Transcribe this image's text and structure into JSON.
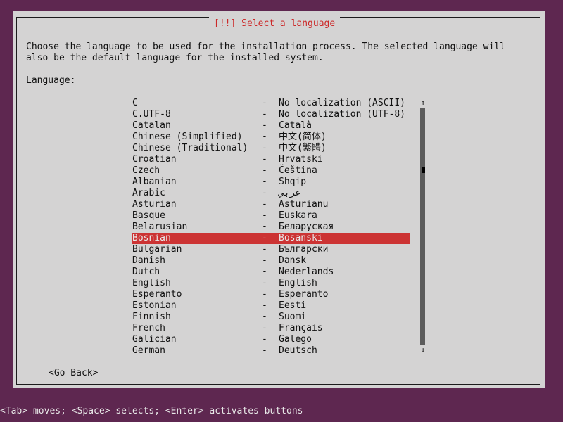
{
  "dialog": {
    "title": "[!!] Select a language",
    "description": "Choose the language to be used for the installation process. The selected language will also be the default language for the installed system.",
    "field_label": "Language:"
  },
  "languages": [
    {
      "en": "C",
      "dash": "-",
      "native": "No localization (ASCII)"
    },
    {
      "en": "C.UTF-8",
      "dash": "-",
      "native": "No localization (UTF-8)"
    },
    {
      "en": "Catalan",
      "dash": "-",
      "native": "Català"
    },
    {
      "en": "Chinese (Simplified)",
      "dash": "-",
      "native": "中文(简体)"
    },
    {
      "en": "Chinese (Traditional)",
      "dash": "-",
      "native": "中文(繁體)"
    },
    {
      "en": "Croatian",
      "dash": "-",
      "native": "Hrvatski"
    },
    {
      "en": "Czech",
      "dash": "-",
      "native": "Čeština"
    },
    {
      "en": "Albanian",
      "dash": "-",
      "native": "Shqip"
    },
    {
      "en": "Arabic",
      "dash": "-",
      "native": "عربي"
    },
    {
      "en": "Asturian",
      "dash": "-",
      "native": "Asturianu"
    },
    {
      "en": "Basque",
      "dash": "-",
      "native": "Euskara"
    },
    {
      "en": "Belarusian",
      "dash": "-",
      "native": "Беларуская"
    },
    {
      "en": "Bosnian",
      "dash": "-",
      "native": "Bosanski"
    },
    {
      "en": "Bulgarian",
      "dash": "-",
      "native": "Български"
    },
    {
      "en": "Danish",
      "dash": "-",
      "native": "Dansk"
    },
    {
      "en": "Dutch",
      "dash": "-",
      "native": "Nederlands"
    },
    {
      "en": "English",
      "dash": "-",
      "native": "English"
    },
    {
      "en": "Esperanto",
      "dash": "-",
      "native": "Esperanto"
    },
    {
      "en": "Estonian",
      "dash": "-",
      "native": "Eesti"
    },
    {
      "en": "Finnish",
      "dash": "-",
      "native": "Suomi"
    },
    {
      "en": "French",
      "dash": "-",
      "native": "Français"
    },
    {
      "en": "Galician",
      "dash": "-",
      "native": "Galego"
    },
    {
      "en": "German",
      "dash": "-",
      "native": "Deutsch"
    }
  ],
  "selected_language": "Bosnian",
  "scrollbar": {
    "up_glyph": "↑",
    "down_glyph": "↓"
  },
  "buttons": {
    "go_back": "<Go Back>"
  },
  "footer": {
    "help": "<Tab> moves; <Space> selects; <Enter> activates buttons"
  },
  "colors": {
    "background": "#5e2750",
    "dialog": "#d4d3d3",
    "title": "#cc2929",
    "highlight": "#cc3333"
  }
}
